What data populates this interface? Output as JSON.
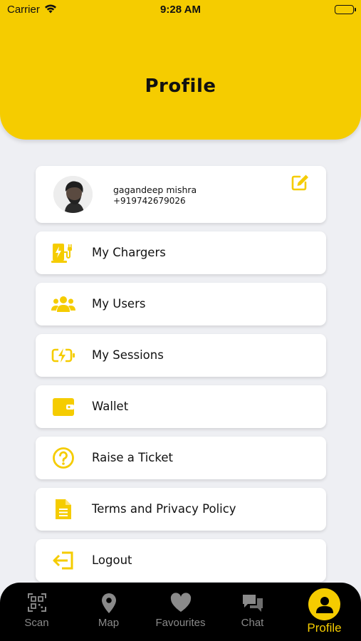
{
  "status_bar": {
    "carrier": "Carrier",
    "time": "9:28 AM"
  },
  "header": {
    "title": "Profile",
    "color": "#f5cc00"
  },
  "profile": {
    "name": "gagandeep mishra",
    "phone": "+919742679026"
  },
  "menu": {
    "items": [
      {
        "label": "My Chargers",
        "icon": "charger-icon"
      },
      {
        "label": "My Users",
        "icon": "users-icon"
      },
      {
        "label": "My Sessions",
        "icon": "battery-charging-icon"
      },
      {
        "label": "Wallet",
        "icon": "wallet-icon"
      },
      {
        "label": "Raise a Ticket",
        "icon": "question-icon"
      },
      {
        "label": "Terms and Privacy Policy",
        "icon": "document-icon"
      },
      {
        "label": "Logout",
        "icon": "logout-icon"
      }
    ]
  },
  "tabs": [
    {
      "label": "Scan",
      "icon": "qr-code-icon"
    },
    {
      "label": "Map",
      "icon": "map-pin-icon"
    },
    {
      "label": "Favourites",
      "icon": "heart-icon"
    },
    {
      "label": "Chat",
      "icon": "chat-icon"
    },
    {
      "label": "Profile",
      "icon": "person-icon",
      "active": true
    }
  ],
  "colors": {
    "accent": "#f5cc00",
    "tab_inactive": "#8a8a8a",
    "background": "#eeeff3"
  }
}
